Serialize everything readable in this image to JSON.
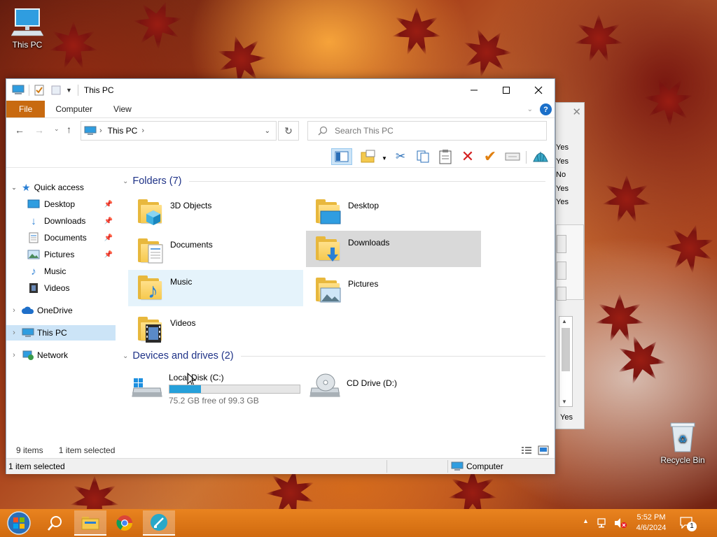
{
  "desktop": {
    "this_pc_label": "This PC",
    "recycle_bin_label": "Recycle Bin"
  },
  "window": {
    "title": "This PC",
    "ribbon_tabs": [
      "File",
      "Computer",
      "View"
    ],
    "address_crumb": "This PC",
    "search_placeholder": "Search This PC",
    "help_glyph": "?"
  },
  "nav": {
    "quick_access": "Quick access",
    "quick_items": [
      "Desktop",
      "Downloads",
      "Documents",
      "Pictures",
      "Music",
      "Videos"
    ],
    "onedrive": "OneDrive",
    "this_pc": "This PC",
    "network": "Network"
  },
  "content": {
    "folders_header": "Folders (7)",
    "folders": [
      "3D Objects",
      "Desktop",
      "Documents",
      "Downloads",
      "Music",
      "Pictures",
      "Videos"
    ],
    "drives_header": "Devices and drives (2)",
    "drives": [
      {
        "name": "Local Disk (C:)",
        "free_text": "75.2 GB free of 99.3 GB",
        "used_fraction": 0.243
      },
      {
        "name": "CD Drive (D:)"
      }
    ]
  },
  "status": {
    "item_count": "9 items",
    "selected": "1 item selected",
    "bottom_selected": "1 item selected",
    "bottom_location": "Computer"
  },
  "side_panel": {
    "values": [
      "Yes",
      "Yes",
      "No",
      "Yes",
      "Yes"
    ],
    "bottom_value": "Yes"
  },
  "taskbar": {
    "time": "5:52 PM",
    "date": "4/6/2024",
    "notification_count": "1"
  },
  "colors": {
    "file_tab": "#c86a10",
    "selection": "#cce4f7",
    "header_text": "#1e3287",
    "drive_bar": "#26a0da",
    "taskbar": "#e07818"
  }
}
